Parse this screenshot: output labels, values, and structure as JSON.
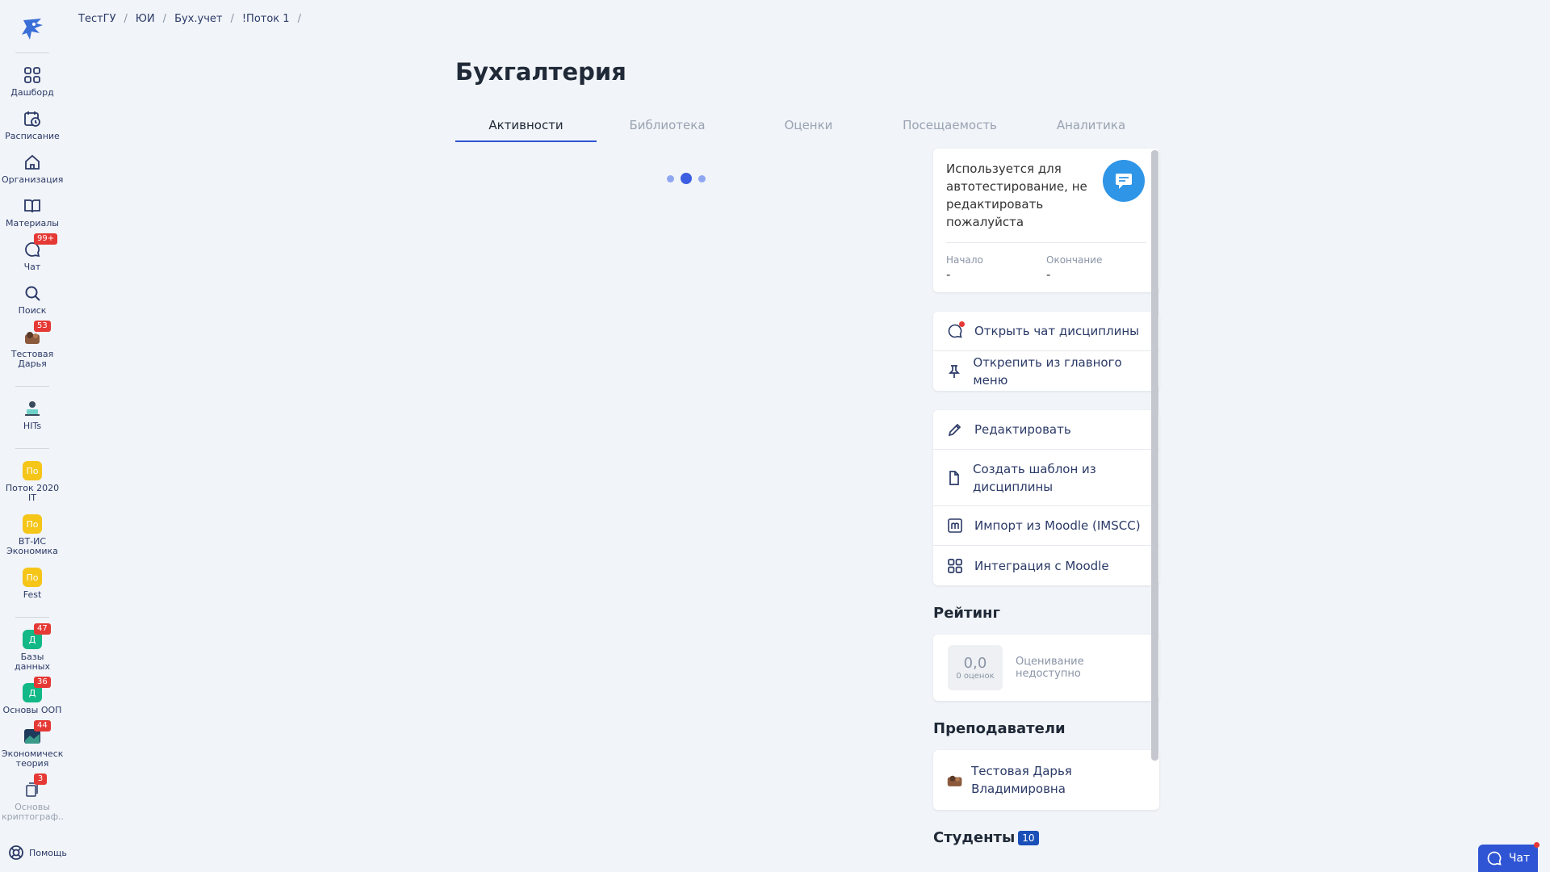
{
  "breadcrumb": [
    "ТестГУ",
    "ЮИ",
    "Бух.учет",
    "!Поток 1"
  ],
  "sidebar": {
    "items": [
      {
        "label": "Дашборд"
      },
      {
        "label": "Расписание"
      },
      {
        "label": "Организация"
      },
      {
        "label": "Материалы"
      },
      {
        "label": "Чат",
        "badge": "99+"
      },
      {
        "label": "Поиск"
      },
      {
        "label": "Тестовая Дарья",
        "badge": "53"
      },
      {
        "label": "HITs"
      },
      {
        "label": "Поток 2020 IT",
        "initial": "По"
      },
      {
        "label": "ВТ-ИС Экономика",
        "initial": "По"
      },
      {
        "label": "Fest",
        "initial": "По"
      },
      {
        "label": "Базы данных",
        "initial": "Д",
        "badge": "47"
      },
      {
        "label": "Основы ООП",
        "initial": "Д",
        "badge": "36"
      },
      {
        "label": "Экономическая теория",
        "badge": "44"
      },
      {
        "label": "Основы криптограф...",
        "badge": "3"
      }
    ],
    "help": "Помощь"
  },
  "page": {
    "title": "Бухгалтерия"
  },
  "tabs": [
    "Активности",
    "Библиотека",
    "Оценки",
    "Посещаемость",
    "Аналитика"
  ],
  "info": {
    "description": "Используется для автотестирование, не редактировать пожалуйста",
    "start_label": "Начало",
    "start_value": "-",
    "end_label": "Окончание",
    "end_value": "-"
  },
  "actions_top": [
    "Открыть чат дисциплины",
    "Открепить из главного меню"
  ],
  "actions_bottom": [
    "Редактировать",
    "Создать шаблон из дисциплины",
    "Импорт из Moodle (IMSCC)",
    "Интеграция с Moodle"
  ],
  "rating": {
    "title": "Рейтинг",
    "value": "0,0",
    "count": "0 оценок",
    "note": "Оценивание недоступно"
  },
  "teachers": {
    "title": "Преподаватели",
    "name": "Тестовая Дарья Владимировна"
  },
  "students": {
    "title": "Студенты",
    "count": "10"
  },
  "chat_button": "Чат",
  "colors": {
    "accent": "#2f55d4",
    "badge": "#e53935",
    "yellow": "#f5c518",
    "green": "#12b886"
  }
}
